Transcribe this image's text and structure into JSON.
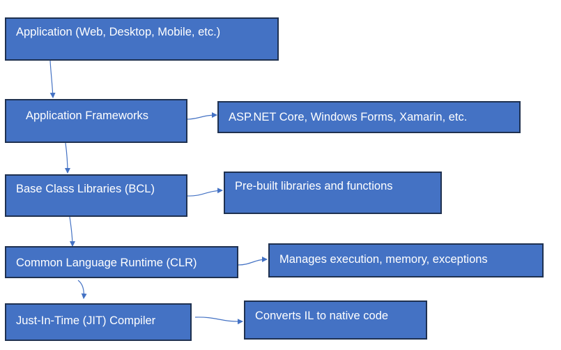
{
  "colors": {
    "box_fill": "#4472c4",
    "box_border": "#1f3150",
    "arrow": "#4472c4",
    "text": "#ffffff"
  },
  "nodes": {
    "application": "Application (Web, Desktop, Mobile, etc.)",
    "frameworks": "Application Frameworks",
    "frameworks_detail": "ASP.NET Core, Windows Forms, Xamarin, etc.",
    "bcl": "Base Class Libraries (BCL)",
    "bcl_detail": "Pre-built libraries and functions",
    "clr": "Common Language Runtime (CLR)",
    "clr_detail": "Manages execution, memory, exceptions",
    "jit": "Just-In-Time (JIT) Compiler",
    "jit_detail": "Converts IL to native code"
  }
}
